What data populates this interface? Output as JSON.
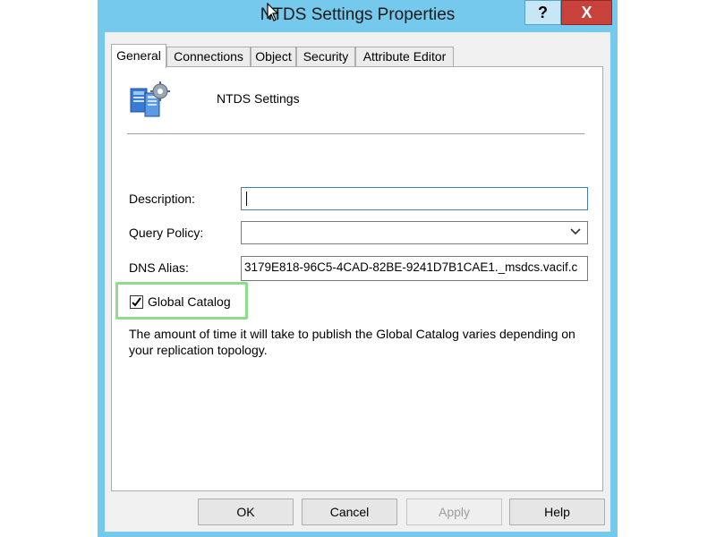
{
  "window": {
    "title": "NTDS Settings Properties",
    "help_glyph": "?",
    "close_glyph": "X"
  },
  "tabs": [
    {
      "label": "General",
      "active": true
    },
    {
      "label": "Connections",
      "active": false
    },
    {
      "label": "Object",
      "active": false
    },
    {
      "label": "Security",
      "active": false
    },
    {
      "label": "Attribute Editor",
      "active": false
    }
  ],
  "general": {
    "object_name": "NTDS Settings",
    "object_icon": "ntds-settings-icon",
    "description_label": "Description:",
    "description_value": "",
    "query_policy_label": "Query Policy:",
    "query_policy_value": "",
    "dns_alias_label": "DNS Alias:",
    "dns_alias_value": "3179E818-96C5-4CAD-82BE-9241D7B1CAE1._msdcs.vacif.c",
    "global_catalog_label": "Global Catalog",
    "global_catalog_checked": true,
    "global_catalog_check_glyph": "✔",
    "info_text": "The amount of time it will take to publish the Global Catalog varies depending on your replication topology."
  },
  "buttons": {
    "ok": "OK",
    "cancel": "Cancel",
    "apply": "Apply",
    "help": "Help"
  },
  "colors": {
    "title_bar": "#74c9ec",
    "close_button": "#c9413b",
    "highlight": "#8edc8c"
  }
}
